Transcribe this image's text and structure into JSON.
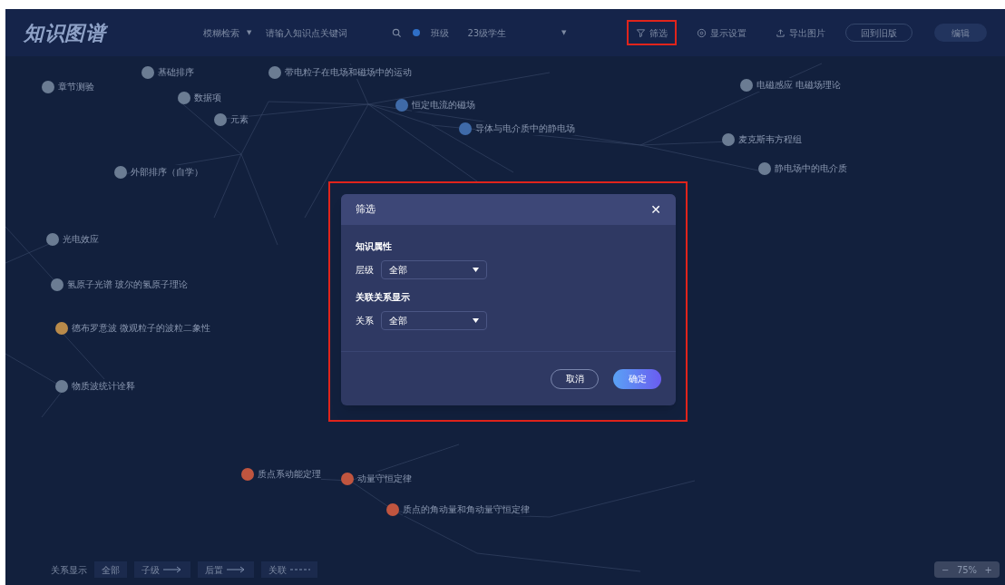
{
  "header": {
    "logo": "知识图谱",
    "search_mode": {
      "value": "模糊检索",
      "caret": "▼"
    },
    "search": {
      "placeholder": "请输入知识点关键词"
    },
    "class_label": "班级",
    "class_select": {
      "value": "23级学生",
      "caret": "▼"
    },
    "tools": [
      {
        "kind": "filter",
        "label": "筛选",
        "highlighted": true
      },
      {
        "kind": "settings",
        "label": "显示设置",
        "highlighted": false
      },
      {
        "kind": "export",
        "label": "导出图片",
        "highlighted": false
      }
    ],
    "buttons": [
      {
        "kind": "outline",
        "label": "回到旧版"
      },
      {
        "kind": "primary",
        "label": "编辑"
      }
    ]
  },
  "graph": {
    "nodes": [
      {
        "label": "章节测验",
        "color": "#6b7c93"
      },
      {
        "label": "基础排序",
        "color": "#6b7c93"
      },
      {
        "label": "数据项",
        "color": "#6b7c93"
      },
      {
        "label": "元素",
        "color": "#6b7c93"
      },
      {
        "label": "外部排序（自学）",
        "color": "#6b7c93"
      },
      {
        "label": "恒定电流的磁场",
        "color": "#3f6aa8"
      },
      {
        "label": "带电粒子在电场和磁场中的运动",
        "color": "#6b7c93"
      },
      {
        "label": "导体与电介质中的静电场",
        "color": "#3f6aa8"
      },
      {
        "label": "光电效应",
        "color": "#6b7c93"
      },
      {
        "label": "氢原子光谱 玻尔的氢原子理论",
        "color": "#6b7c93"
      },
      {
        "label": "德布罗意波 微观粒子的波粒二象性",
        "color": "#b98a4a"
      },
      {
        "label": "物质波统计诠释",
        "color": "#6b7c93"
      },
      {
        "label": "电磁感应 电磁场理论",
        "color": "#6b7c93"
      },
      {
        "label": "麦克斯韦方程组",
        "color": "#6b7c93"
      },
      {
        "label": "静电场中的电介质",
        "color": "#6b7c93"
      },
      {
        "label": "动量守恒定律",
        "color": "#c0553f"
      },
      {
        "label": "质点的角动量和角动量守恒定律",
        "color": "#c0553f"
      },
      {
        "label": "质点系动能定理",
        "color": "#c0553f"
      }
    ]
  },
  "dialog": {
    "title": "筛选",
    "close": "✕",
    "highlighted": true,
    "sections": [
      {
        "heading": "知识属性",
        "label": "层级",
        "value": "全部"
      },
      {
        "heading": "关联关系显示",
        "label": "关系",
        "value": "全部"
      }
    ],
    "buttons": [
      {
        "kind": "outline",
        "label": "取消"
      },
      {
        "kind": "primary",
        "label": "确定"
      }
    ]
  },
  "legend": {
    "label": "关系显示",
    "items": [
      {
        "label": "全部",
        "kind": "plain"
      },
      {
        "label": "子级",
        "kind": "arrow"
      },
      {
        "label": "后置",
        "kind": "arrow"
      },
      {
        "label": "关联",
        "kind": "dashed"
      }
    ]
  },
  "zoom": {
    "minus": "−",
    "value": "75%",
    "plus": "+"
  }
}
